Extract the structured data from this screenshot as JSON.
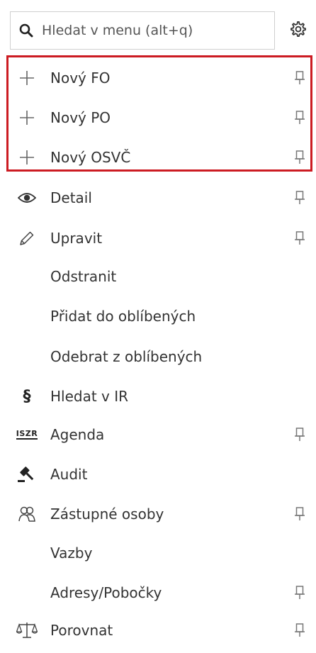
{
  "search": {
    "placeholder": "Hledat v menu (alt+q)",
    "icon": "search-icon"
  },
  "settings": {
    "icon": "gear-icon"
  },
  "menu": {
    "items": [
      {
        "label": "Nový FO",
        "icon": "plus-icon",
        "pinned": true
      },
      {
        "label": "Nový PO",
        "icon": "plus-icon",
        "pinned": true
      },
      {
        "label": "Nový OSVČ",
        "icon": "plus-icon",
        "pinned": true
      },
      {
        "label": "Detail",
        "icon": "eye-icon",
        "pinned": true
      },
      {
        "label": "Upravit",
        "icon": "pencil-icon",
        "pinned": true
      },
      {
        "label": "Odstranit",
        "icon": "",
        "pinned": false
      },
      {
        "label": "Přidat do oblíbených",
        "icon": "",
        "pinned": false
      },
      {
        "label": "Odebrat z oblíbených",
        "icon": "",
        "pinned": false
      },
      {
        "label": "Hledat v IR",
        "icon": "section-sign-icon",
        "pinned": false
      },
      {
        "label": "Agenda",
        "icon": "iszr-icon",
        "icon_text": "ISZR",
        "pinned": true
      },
      {
        "label": "Audit",
        "icon": "gavel-icon",
        "pinned": false
      },
      {
        "label": "Zástupné osoby",
        "icon": "people-icon",
        "pinned": true
      },
      {
        "label": "Vazby",
        "icon": "",
        "pinned": false
      },
      {
        "label": "Adresy/Pobočky",
        "icon": "",
        "pinned": true
      },
      {
        "label": "Porovnat",
        "icon": "balance-scale-icon",
        "pinned": true
      }
    ]
  },
  "colors": {
    "highlight_border": "#cc1b22",
    "text": "#333333",
    "icon": "#555555"
  }
}
